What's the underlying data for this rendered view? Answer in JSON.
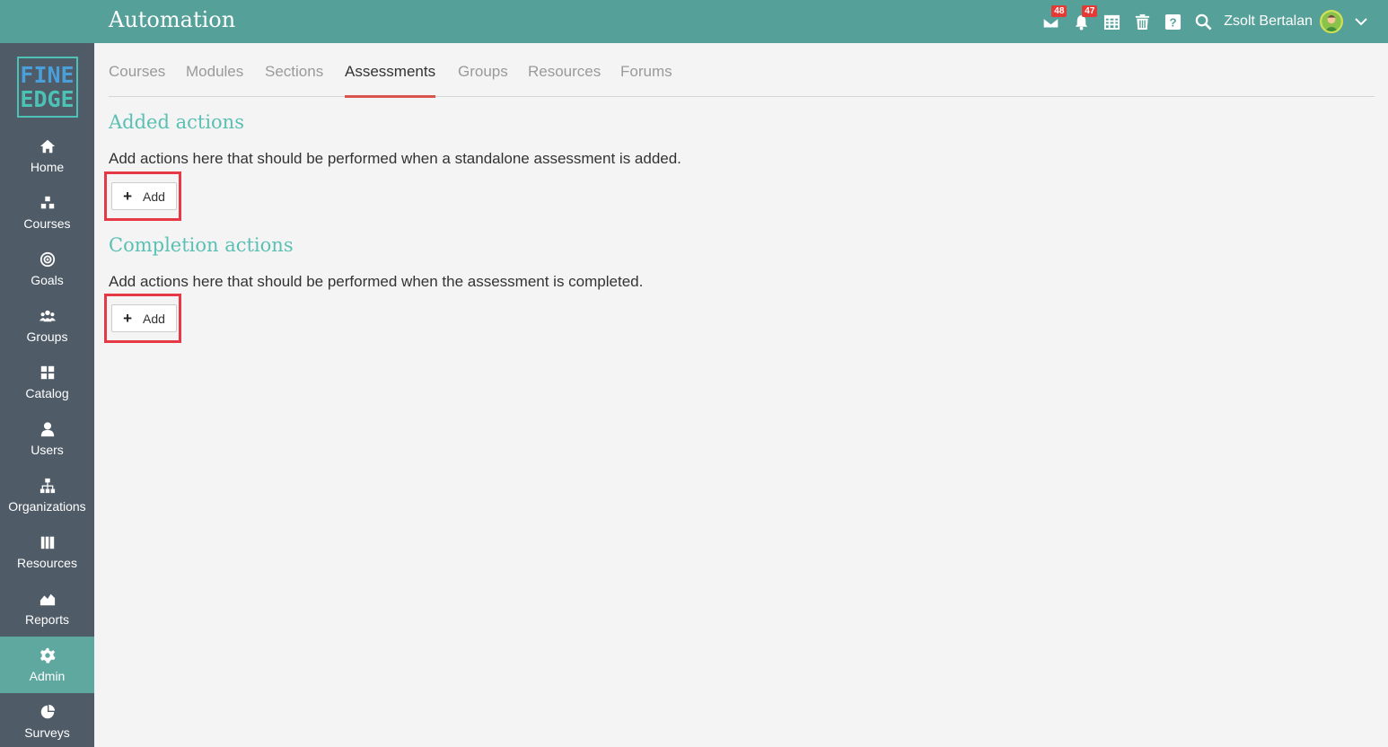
{
  "app": {
    "title": "Automation"
  },
  "logo": {
    "line1": "FINE",
    "line2": "EDGE"
  },
  "sidebar": {
    "items": [
      {
        "label": "Home",
        "icon": "home-icon"
      },
      {
        "label": "Courses",
        "icon": "courses-icon"
      },
      {
        "label": "Goals",
        "icon": "target-icon"
      },
      {
        "label": "Groups",
        "icon": "groups-icon"
      },
      {
        "label": "Catalog",
        "icon": "grid-icon"
      },
      {
        "label": "Users",
        "icon": "user-icon"
      },
      {
        "label": "Organizations",
        "icon": "sitemap-icon"
      },
      {
        "label": "Resources",
        "icon": "books-icon"
      },
      {
        "label": "Reports",
        "icon": "chart-area-icon"
      },
      {
        "label": "Admin",
        "icon": "gear-icon",
        "active": true
      },
      {
        "label": "Surveys",
        "icon": "pie-chart-icon"
      }
    ]
  },
  "header": {
    "messages_badge": "48",
    "notifications_badge": "47",
    "user_name": "Zsolt Bertalan"
  },
  "tabs": [
    "Courses",
    "Modules",
    "Sections",
    "Assessments",
    "Groups",
    "Resources",
    "Forums"
  ],
  "active_tab": "Assessments",
  "sections": {
    "added": {
      "title": "Added actions",
      "description": "Add actions here that should be performed when a standalone assessment is added.",
      "button": "Add"
    },
    "completion": {
      "title": "Completion actions",
      "description": "Add actions here that should be performed when the assessment is completed.",
      "button": "Add"
    }
  },
  "colors": {
    "header": "#55a099",
    "sidebar": "#4f5b67",
    "accent_title": "#5bc0b4",
    "tab_underline": "#d9534f",
    "highlight_box": "#e63946"
  }
}
